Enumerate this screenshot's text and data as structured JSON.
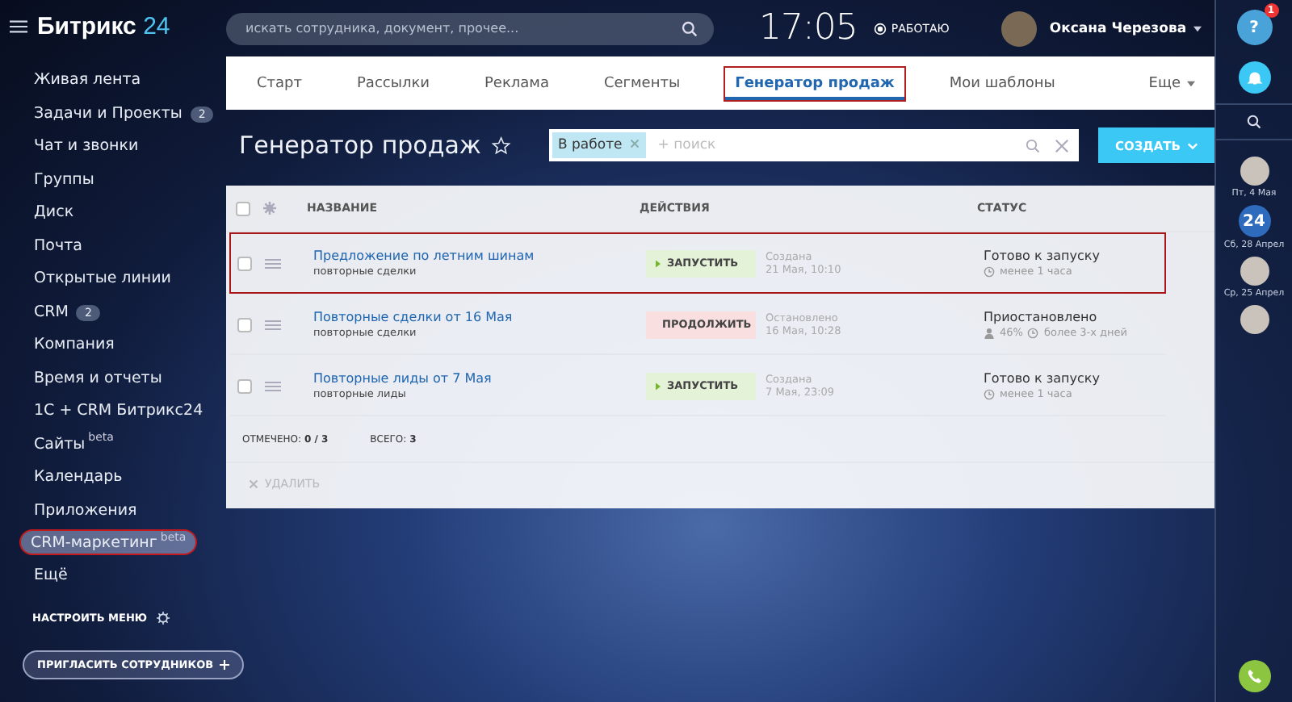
{
  "header": {
    "logo_word": "Битрикс",
    "logo_number": "24",
    "search": {
      "placeholder": "искать сотрудника, документ, прочее..."
    },
    "time": "17:05",
    "work_status": "РАБОТАЮ",
    "user_name": "Оксана Черезова"
  },
  "sidebar": {
    "items": [
      {
        "label": "Живая лента",
        "selected": false,
        "highlighted": false
      },
      {
        "label": "Задачи и Проекты",
        "badge": "2",
        "selected": false,
        "highlighted": false
      },
      {
        "label": "Чат и звонки",
        "selected": false,
        "highlighted": false
      },
      {
        "label": "Группы",
        "selected": false,
        "highlighted": false
      },
      {
        "label": "Диск",
        "selected": false,
        "highlighted": false
      },
      {
        "label": "Почта",
        "selected": false,
        "highlighted": false
      },
      {
        "label": "Открытые линии",
        "selected": false,
        "highlighted": false
      },
      {
        "label": "CRM",
        "badge": "2",
        "selected": false,
        "highlighted": false
      },
      {
        "label": "Компания",
        "selected": false,
        "highlighted": false
      },
      {
        "label": "Время и отчеты",
        "selected": false,
        "highlighted": false
      },
      {
        "label": "1С + CRM Битрикс24",
        "selected": false,
        "highlighted": false
      },
      {
        "label": "Сайты",
        "tag": "beta",
        "selected": false,
        "highlighted": false
      },
      {
        "label": "Календарь",
        "selected": false,
        "highlighted": false
      },
      {
        "label": "Приложения",
        "selected": false,
        "highlighted": false
      },
      {
        "label": "CRM-маркетинг",
        "tag": "beta",
        "selected": true,
        "highlighted": true
      },
      {
        "label": "Ещё",
        "selected": false,
        "highlighted": false
      }
    ],
    "configure": "НАСТРОИТЬ МЕНЮ",
    "invite": "ПРИГЛАСИТЬ СОТРУДНИКОВ"
  },
  "tabs": [
    {
      "label": "Старт",
      "selected": false,
      "highlighted": false
    },
    {
      "label": "Рассылки",
      "selected": false,
      "highlighted": false
    },
    {
      "label": "Реклама",
      "selected": false,
      "highlighted": false
    },
    {
      "label": "Сегменты",
      "selected": false,
      "highlighted": false
    },
    {
      "label": "Генератор продаж",
      "selected": true,
      "highlighted": true
    },
    {
      "label": "Мои шаблоны",
      "selected": false,
      "highlighted": false
    }
  ],
  "more_tab": "Еще",
  "page_title": "Генератор продаж",
  "filter": {
    "tag": "В работе",
    "placeholder": "+ поиск"
  },
  "create_button": "СОЗДАТЬ",
  "table": {
    "all_checked": false,
    "columns": [
      "НАЗВАНИЕ",
      "ДЕЙСТВИЯ",
      "СТАТУС"
    ],
    "rows": [
      {
        "name": "Предложение по летним шинам",
        "subtitle": "повторные сделки",
        "action": {
          "kind": "start",
          "label": "ЗАПУСТИТЬ"
        },
        "date_label": "Создана",
        "date": "21 Мая, 10:10",
        "status": "Готово к запуску",
        "details": [
          {
            "kind": "clock",
            "text": "менее 1 часа"
          }
        ],
        "checked": false,
        "highlighted": true
      },
      {
        "name": "Повторные сделки от 16 Мая",
        "subtitle": "повторные сделки",
        "action": {
          "kind": "continue",
          "label": "ПРОДОЛЖИТЬ"
        },
        "date_label": "Остановлено",
        "date": "16 Мая, 10:28",
        "status": "Приостановлено",
        "details": [
          {
            "kind": "person",
            "text": "46%"
          },
          {
            "kind": "clock",
            "text": "более 3-х дней"
          }
        ],
        "checked": false,
        "highlighted": false
      },
      {
        "name": "Повторные лиды от 7 Мая",
        "subtitle": "повторные лиды",
        "action": {
          "kind": "start",
          "label": "ЗАПУСТИТЬ"
        },
        "date_label": "Создана",
        "date": "7 Мая, 23:09",
        "status": "Готово к запуску",
        "details": [
          {
            "kind": "clock",
            "text": "менее 1 часа"
          }
        ],
        "checked": false,
        "highlighted": false
      }
    ],
    "selected_count": "ОТМЕЧЕНО: **0 / 3**",
    "total": "ВСЕГО: **3**",
    "delete": {
      "label": "УДАЛИТЬ",
      "disabled": true
    }
  },
  "right_bar": {
    "help_label": "?",
    "help_badge": "1",
    "items": [
      {
        "kind": "avatar",
        "date": "Пт, 4 Мая"
      },
      {
        "kind": "chat",
        "label": "24",
        "date": "Сб, 28 Апрел"
      },
      {
        "kind": "avatar",
        "date": "Ср, 25 Апрел"
      },
      {
        "kind": "avatar"
      }
    ]
  }
}
